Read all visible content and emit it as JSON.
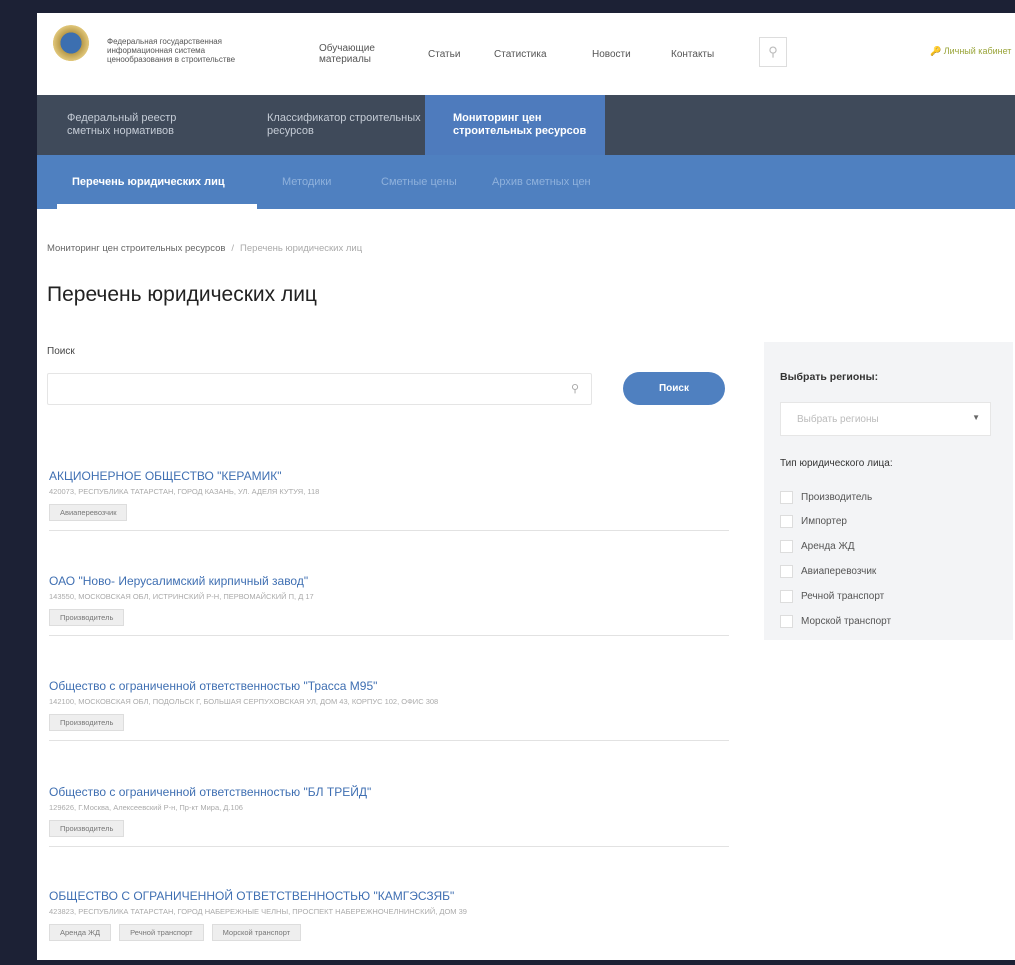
{
  "header": {
    "org_line1": "Федеральная государственная",
    "org_line2": "информационная система",
    "org_line3": "ценообразования в строительстве",
    "nav": [
      "Обучающие материалы",
      "Статьи",
      "Статистика",
      "Новости",
      "Контакты"
    ],
    "search_icon": "search-icon",
    "cabinet": "Личный кабинет"
  },
  "registry_nav": [
    "Федеральный реестр сметных нормативов",
    "Классификатор строительных ресурсов",
    "Мониторинг цен строительных ресурсов"
  ],
  "sub_nav": [
    "Перечень юридических лиц",
    "Методики",
    "Сметные цены",
    "Архив сметных цен"
  ],
  "breadcrumb": {
    "parent": "Мониторинг цен строительных ресурсов",
    "current": "Перечень юридических лиц"
  },
  "page_title": "Перечень юридических лиц",
  "search": {
    "label": "Поиск",
    "placeholder": "",
    "button": "Поиск"
  },
  "entries": [
    {
      "name": "АКЦИОНЕРНОЕ ОБЩЕСТВО \"КЕРАМИК\"",
      "address": "420073, РЕСПУБЛИКА ТАТАРСТАН, ГОРОД КАЗАНЬ, УЛ. АДЕЛЯ КУТУЯ, 118",
      "tags": [
        "Авиаперевозчик"
      ]
    },
    {
      "name": "ОАО \"Ново- Иерусалимский кирпичный завод\"",
      "address": "143550, МОСКОВСКАЯ ОБЛ, ИСТРИНСКИЙ Р-Н, ПЕРВОМАЙСКИЙ П, Д 17",
      "tags": [
        "Производитель"
      ]
    },
    {
      "name": "Общество с ограниченной ответственностью \"Трасса М95\"",
      "address": "142100, МОСКОВСКАЯ ОБЛ, ПОДОЛЬСК Г, БОЛЬШАЯ СЕРПУХОВСКАЯ УЛ, ДОМ 43, КОРПУС 102, ОФИС 308",
      "tags": [
        "Производитель"
      ]
    },
    {
      "name": "Общество с ограниченной ответственностью \"БЛ ТРЕЙД\"",
      "address": "129626, Г.Москва, Алексеевский Р-н, Пр-кт Мира, Д.106",
      "tags": [
        "Производитель"
      ]
    },
    {
      "name": "ОБЩЕСТВО С ОГРАНИЧЕННОЙ ОТВЕТСТВЕННОСТЬЮ \"КАМГЭСЗЯБ\"",
      "address": "423823, РЕСПУБЛИКА ТАТАРСТАН, ГОРОД НАБЕРЕЖНЫЕ ЧЕЛНЫ, ПРОСПЕКТ НАБЕРЕЖНОЧЕЛНИНСКИЙ, ДОМ 39",
      "tags": [
        "Аренда ЖД",
        "Речной транспорт",
        "Морской транспорт"
      ]
    }
  ],
  "filters": {
    "regions_title": "Выбрать регионы:",
    "regions_placeholder": "Выбрать регионы",
    "type_title": "Тип юридического лица:",
    "types": [
      "Производитель",
      "Импортер",
      "Аренда ЖД",
      "Авиаперевозчик",
      "Речной транспорт",
      "Морской транспорт"
    ]
  }
}
